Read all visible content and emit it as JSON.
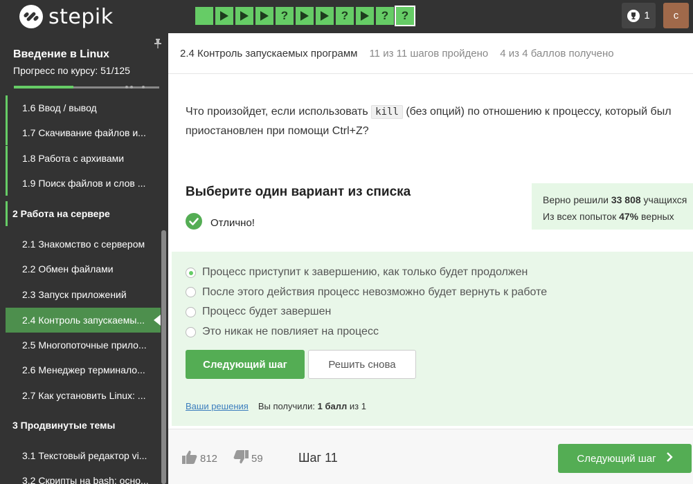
{
  "app": {
    "logo_text": "stepik",
    "score_count": "1",
    "avatar_letter": "с"
  },
  "step_bar": {
    "steps": [
      {
        "type": "text",
        "state": "solved"
      },
      {
        "type": "video",
        "state": "solved"
      },
      {
        "type": "video",
        "state": "solved"
      },
      {
        "type": "video",
        "state": "solved"
      },
      {
        "type": "quiz",
        "state": "solved",
        "label": "?"
      },
      {
        "type": "video",
        "state": "solved"
      },
      {
        "type": "video",
        "state": "solved"
      },
      {
        "type": "quiz",
        "state": "solved",
        "label": "?"
      },
      {
        "type": "video",
        "state": "solved"
      },
      {
        "type": "quiz",
        "state": "solved",
        "label": "?"
      },
      {
        "type": "quiz",
        "state": "current",
        "label": "?"
      }
    ],
    "color": "#66cc66"
  },
  "sidebar": {
    "course_title": "Введение в Linux",
    "progress_text": "Прогресс по курсу:  51/125",
    "progress_fraction": 0.408,
    "items": [
      {
        "label": "1.6  Ввод / вывод",
        "kind": "lesson"
      },
      {
        "label": "1.7  Скачивание файлов и...",
        "kind": "lesson"
      },
      {
        "label": "1.8  Работа с архивами",
        "kind": "lesson"
      },
      {
        "label": "1.9  Поиск файлов и слов ...",
        "kind": "lesson"
      },
      {
        "label": "2  Работа на сервере",
        "kind": "section"
      },
      {
        "label": "2.1  Знакомство с сервером",
        "kind": "lesson"
      },
      {
        "label": "2.2  Обмен файлами",
        "kind": "lesson"
      },
      {
        "label": "2.3  Запуск приложений",
        "kind": "lesson"
      },
      {
        "label": "2.4  Контроль запускаемы...",
        "kind": "lesson",
        "active": true
      },
      {
        "label": "2.5  Многопоточные прило...",
        "kind": "lesson"
      },
      {
        "label": "2.6  Менеджер терминало...",
        "kind": "lesson"
      },
      {
        "label": "2.7  Как установить Linux: ...",
        "kind": "lesson"
      },
      {
        "label": "3  Продвинутые темы",
        "kind": "section"
      },
      {
        "label": "3.1  Текстовый редактор vi...",
        "kind": "lesson"
      },
      {
        "label": "3.2  Скрипты на bash: осно...",
        "kind": "lesson"
      }
    ]
  },
  "lesson": {
    "title": "2.4 Контроль запускаемых программ",
    "steps_passed": "11 из 11 шагов пройдено",
    "score": "4 из 4 баллов  получено"
  },
  "question": {
    "text_before": "Что произойдет, если использовать ",
    "code": "kill",
    "text_after": " (без опций) по отношению к процессу, который был приостановлен при помощи Ctrl+Z?"
  },
  "quiz": {
    "choose_title": "Выберите один вариант из списка",
    "result_label": "Отлично!",
    "stats_line1_prefix": "Верно решили ",
    "stats_line1_bold": "33 808",
    "stats_line1_suffix": " учащихся",
    "stats_line2_prefix": "Из всех попыток ",
    "stats_line2_bold": "47%",
    "stats_line2_suffix": " верных",
    "options": [
      {
        "label": "Процесс приступит к завершению, как только будет продолжен",
        "selected": true
      },
      {
        "label": "После этого действия процесс невозможно будет вернуть к работе",
        "selected": false
      },
      {
        "label": "Процесс будет завершен",
        "selected": false
      },
      {
        "label": "Это никак не повлияет на процесс",
        "selected": false
      }
    ],
    "next_button": "Следующий шаг",
    "retry_button": "Решить снова",
    "solutions_link": "Ваши решения",
    "received_prefix": "Вы получили: ",
    "received_bold": "1 балл",
    "received_suffix": " из 1"
  },
  "footer": {
    "likes": "812",
    "dislikes": "59",
    "step_label": "Шаг 11",
    "next_button": "Следующий шаг"
  }
}
